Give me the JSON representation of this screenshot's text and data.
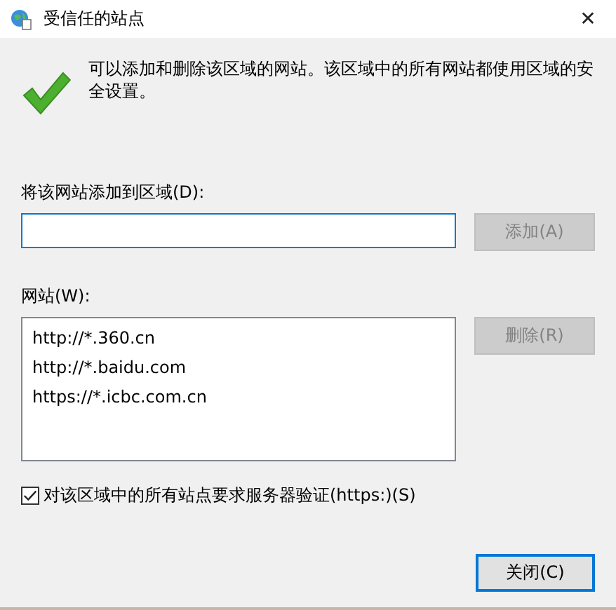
{
  "window": {
    "title": "受信任的站点",
    "close": "✕"
  },
  "info": "可以添加和删除该区域的网站。该区域中的所有网站都使用区域的安全设置。",
  "add_label": "将该网站添加到区域(D):",
  "add_field": {
    "focused": true
  },
  "add_button": {
    "label": "添加(A)",
    "disabled": true
  },
  "sites_label": "网站(W):",
  "sites": [
    {
      "text": "http://*.360.cn",
      "selected": false
    },
    {
      "text": "http://*.baidu.com",
      "selected": false
    },
    {
      "text": "https://*.icbc.com.cn",
      "selected": false
    }
  ],
  "remove_button": {
    "label": "删除(R)",
    "disabled": true
  },
  "https_check": {
    "label": "对该区域中的所有站点要求服务器验证(https:)(S)",
    "checked": true
  },
  "close_button": {
    "label": "关闭(C)",
    "default": true
  }
}
